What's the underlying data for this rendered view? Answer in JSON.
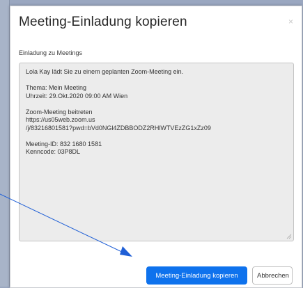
{
  "dialog": {
    "title": "Meeting-Einladung kopieren",
    "close_glyph": "×",
    "section_label": "Einladung zu Meetings",
    "invitation_lines": [
      "Lola Kay lädt Sie zu einem geplanten Zoom-Meeting ein.",
      "",
      "Thema: Mein Meeting",
      "Uhrzeit: 29.Okt.2020 09:00 AM Wien",
      "",
      "Zoom-Meeting beitreten",
      "https://us05web.zoom.us",
      "/j/83216801581?pwd=bVd0NGl4ZDBBODZ2RHlWTVEzZG1xZz09",
      "",
      "Meeting-ID: 832 1680 1581",
      "Kenncode: 03P8DL"
    ],
    "copy_button_label": "Meeting-Einladung kopieren",
    "cancel_button_label": "Abbrechen"
  },
  "colors": {
    "primary_button": "#0e72ed",
    "annotation_arrow": "#1f5fd6",
    "backdrop": "#9aa7c0"
  },
  "icons": {
    "close": "close-icon",
    "resize": "resize-grip-icon",
    "arrow": "annotation-arrow-icon"
  }
}
